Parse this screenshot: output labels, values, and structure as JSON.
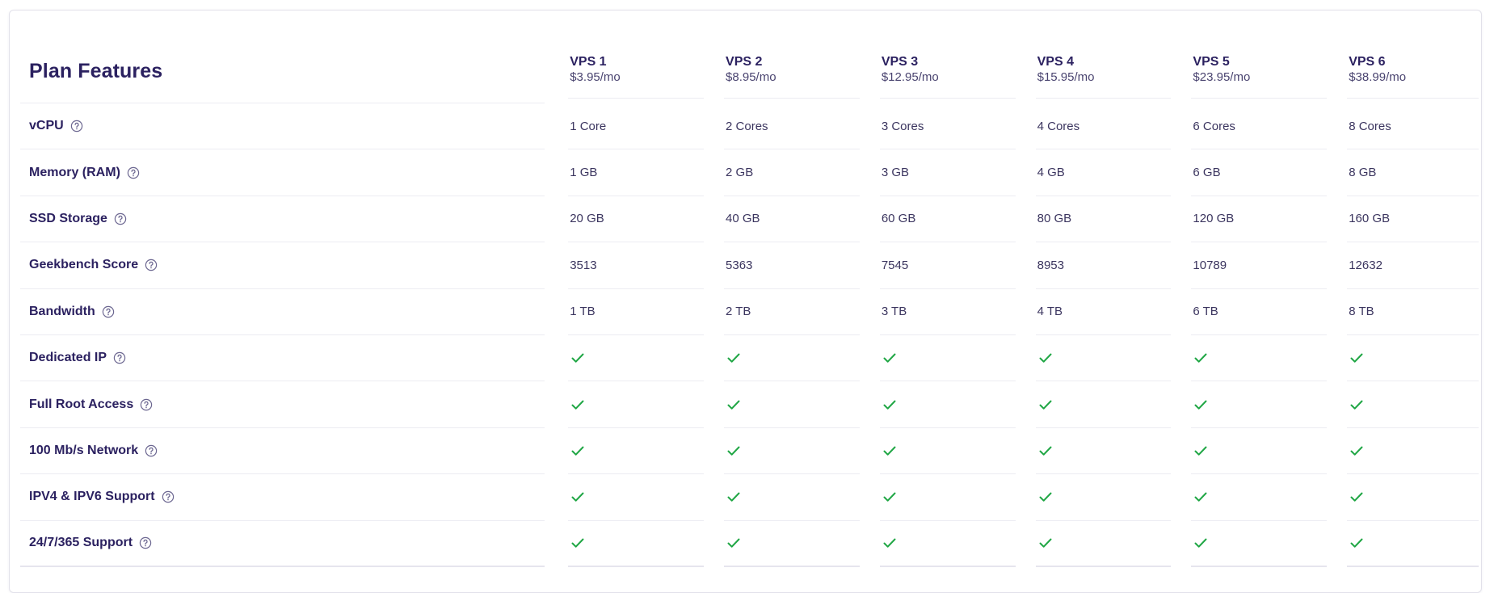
{
  "table": {
    "title": "Plan Features",
    "check_color": "#1fa644",
    "plans": [
      {
        "name": "VPS 1",
        "price": "$3.95/mo"
      },
      {
        "name": "VPS 2",
        "price": "$8.95/mo"
      },
      {
        "name": "VPS 3",
        "price": "$12.95/mo"
      },
      {
        "name": "VPS 4",
        "price": "$15.95/mo"
      },
      {
        "name": "VPS 5",
        "price": "$23.95/mo"
      },
      {
        "name": "VPS 6",
        "price": "$38.99/mo"
      }
    ],
    "features": [
      {
        "label": "vCPU",
        "type": "text",
        "values": [
          "1 Core",
          "2 Cores",
          "3 Cores",
          "4 Cores",
          "6 Cores",
          "8 Cores"
        ]
      },
      {
        "label": "Memory (RAM)",
        "type": "text",
        "values": [
          "1 GB",
          "2 GB",
          "3 GB",
          "4 GB",
          "6 GB",
          "8 GB"
        ]
      },
      {
        "label": "SSD Storage",
        "type": "text",
        "values": [
          "20 GB",
          "40 GB",
          "60 GB",
          "80 GB",
          "120 GB",
          "160 GB"
        ]
      },
      {
        "label": "Geekbench Score",
        "type": "text",
        "values": [
          "3513",
          "5363",
          "7545",
          "8953",
          "10789",
          "12632"
        ]
      },
      {
        "label": "Bandwidth",
        "type": "text",
        "values": [
          "1 TB",
          "2 TB",
          "3 TB",
          "4 TB",
          "6 TB",
          "8 TB"
        ]
      },
      {
        "label": "Dedicated IP",
        "type": "check",
        "values": [
          true,
          true,
          true,
          true,
          true,
          true
        ]
      },
      {
        "label": "Full Root Access",
        "type": "check",
        "values": [
          true,
          true,
          true,
          true,
          true,
          true
        ]
      },
      {
        "label": "100 Mb/s Network",
        "type": "check",
        "values": [
          true,
          true,
          true,
          true,
          true,
          true
        ]
      },
      {
        "label": "IPV4 & IPV6 Support",
        "type": "check",
        "values": [
          true,
          true,
          true,
          true,
          true,
          true
        ]
      },
      {
        "label": "24/7/365 Support",
        "type": "check",
        "values": [
          true,
          true,
          true,
          true,
          true,
          true
        ]
      }
    ]
  }
}
